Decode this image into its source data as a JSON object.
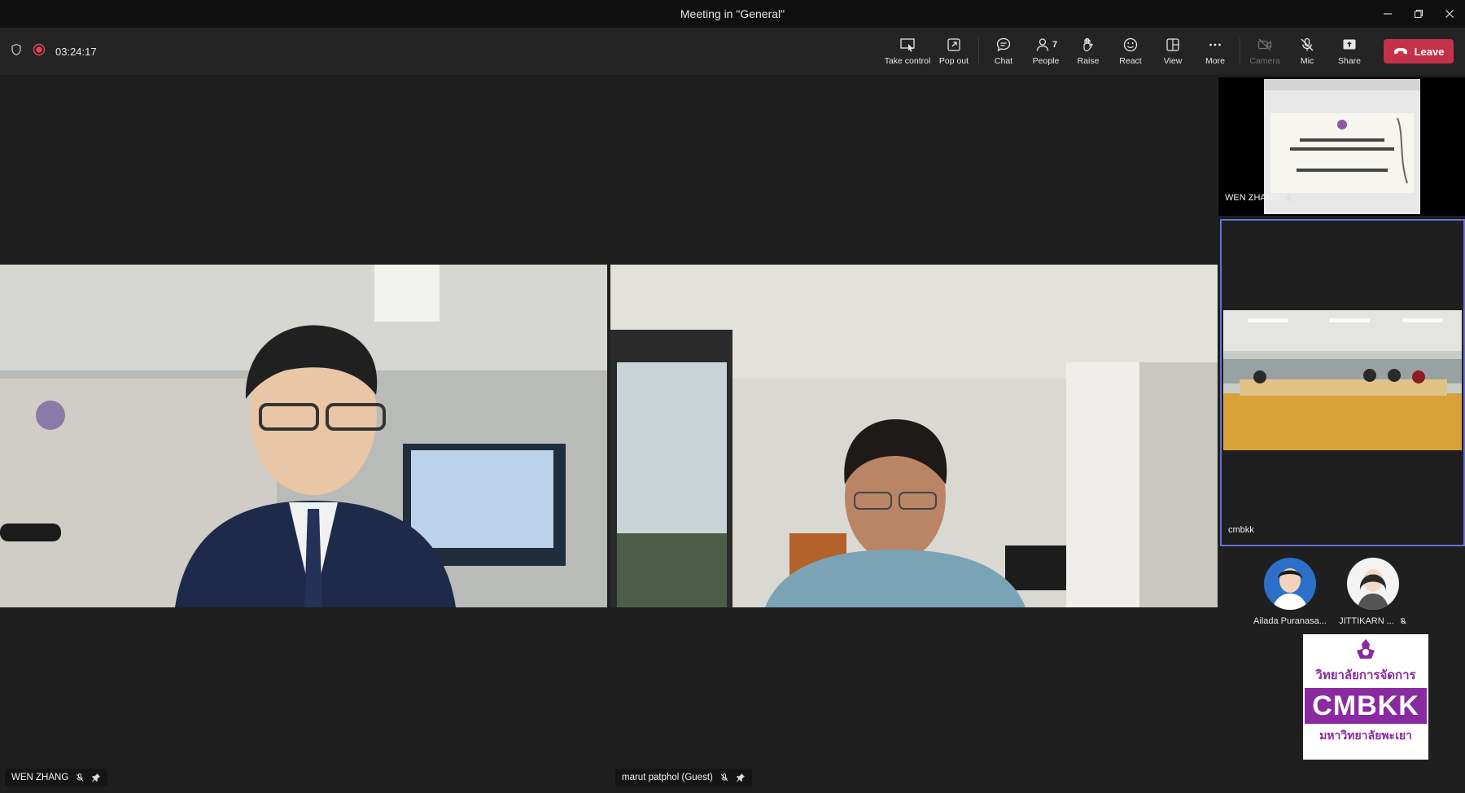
{
  "window": {
    "title": "Meeting in \"General\""
  },
  "toolbar": {
    "timer": "03:24:17",
    "buttons": {
      "take_control": "Take control",
      "pop_out": "Pop out",
      "chat": "Chat",
      "people": "People",
      "people_count": "7",
      "raise": "Raise",
      "react": "React",
      "view": "View",
      "more": "More",
      "camera": "Camera",
      "mic": "Mic",
      "share": "Share"
    },
    "leave_label": "Leave",
    "colors": {
      "leave": "#c4314b",
      "recording": "#e0455a",
      "active_tile_border": "#6b6fd6"
    }
  },
  "stage": {
    "left": {
      "name": "WEN ZHANG"
    },
    "right": {
      "name": "marut patphol (Guest)"
    }
  },
  "rail": {
    "tile1": {
      "name": "WEN ZHANG"
    },
    "tile2": {
      "name": "cmbkk"
    },
    "avatars": [
      {
        "name": "Ailada Puranasa..."
      },
      {
        "name": "JITTIKARN ..."
      }
    ],
    "logo": {
      "line1": "วิทยาลัยการจัดการ",
      "brand": "CMBKK",
      "line2": "มหาวิทยาลัยพะเยา"
    }
  }
}
